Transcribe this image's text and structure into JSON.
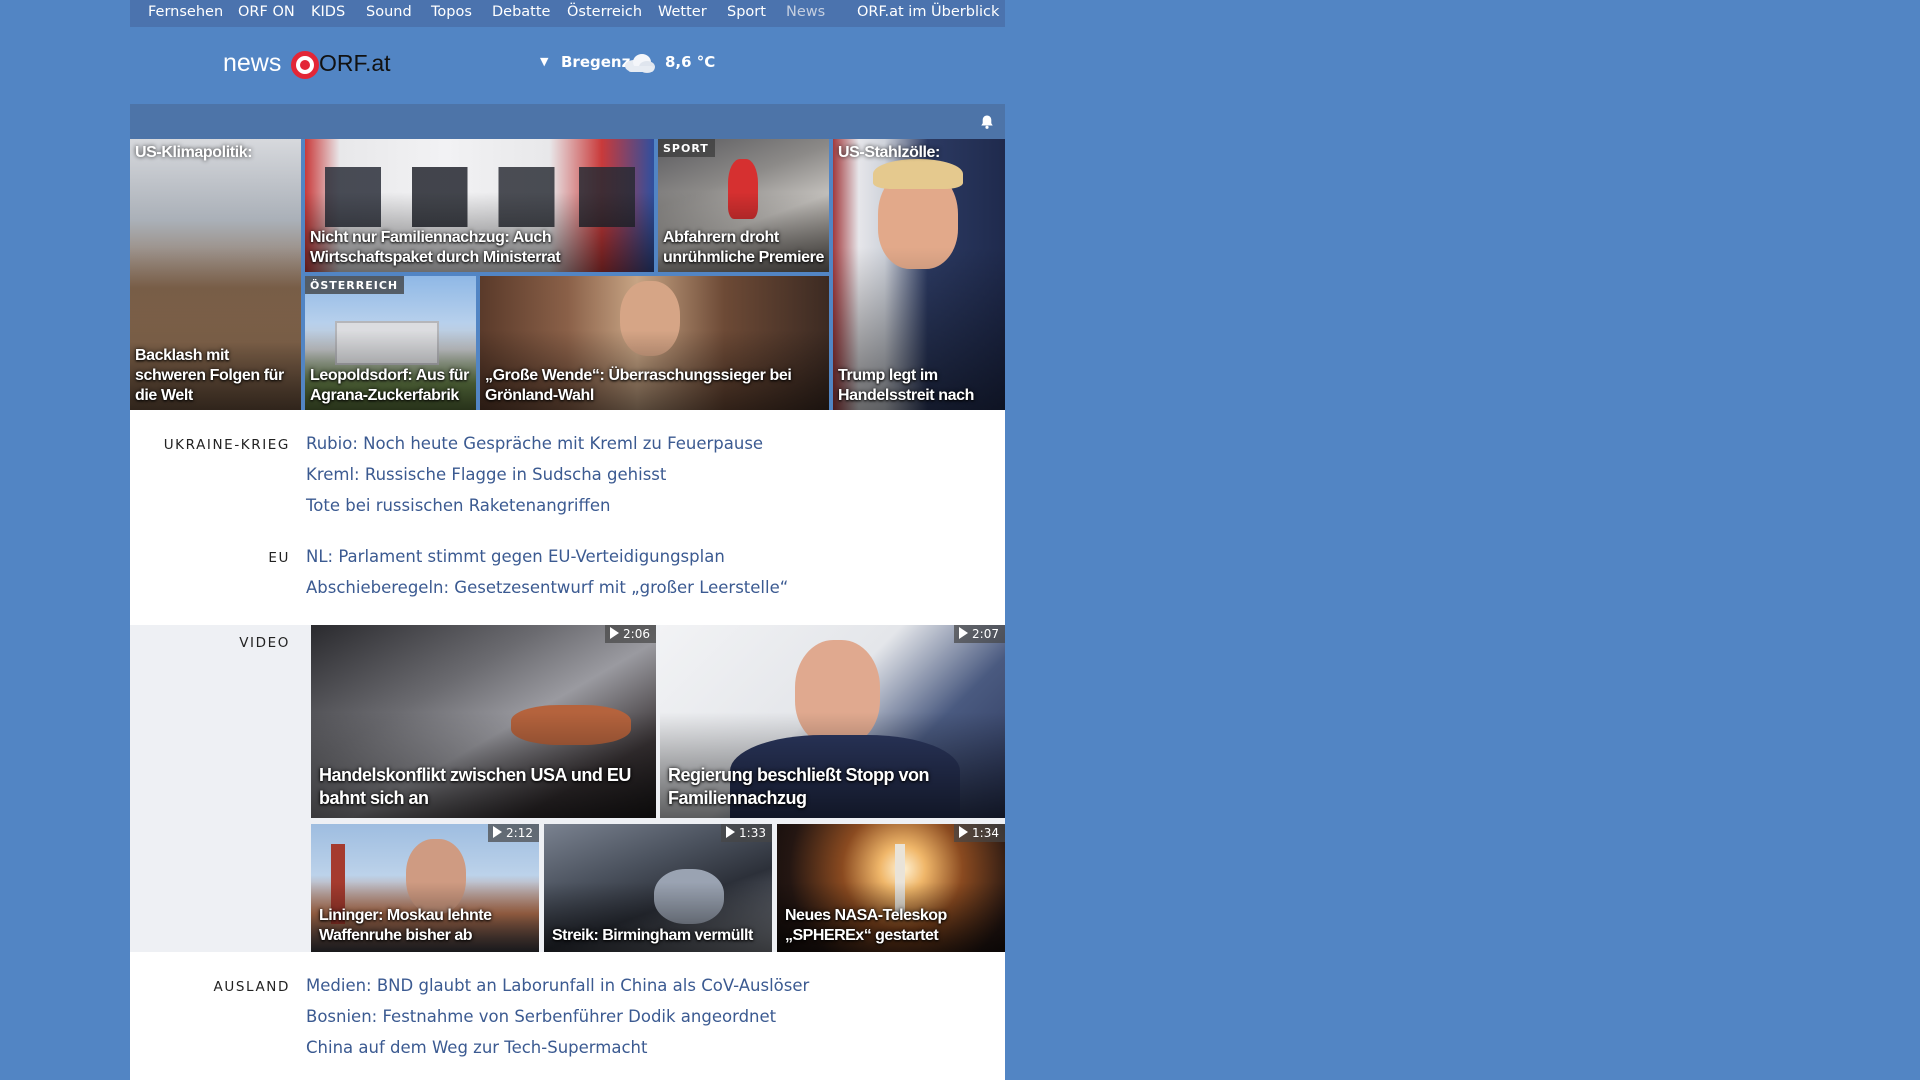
{
  "topnav": {
    "items": [
      "Fernsehen",
      "ORF ON",
      "KIDS",
      "Sound",
      "Topos",
      "Debatte",
      "Österreich",
      "Wetter",
      "Sport",
      "News"
    ],
    "overview": "ORF.at im Überblick"
  },
  "header": {
    "logo_news": "news",
    "logo_orf": "ORF.at",
    "weather_city": "Bregenz",
    "weather_temp": "8,6 °C",
    "weather_icon": "cloud-icon"
  },
  "teasers": [
    {
      "kicker": "US-Klimapolitik:",
      "caption": "Backlash mit schweren Folgen für die Welt"
    },
    {
      "caption": "Nicht nur Familiennachzug: Auch Wirtschaftspaket durch Ministerrat"
    },
    {
      "tag": "SPORT",
      "caption": "Abfahrern droht unrühmliche Premiere"
    },
    {
      "kicker": "US-Stahlzölle:",
      "caption": "Trump legt im Handelsstreit nach"
    },
    {
      "tag": "ÖSTERREICH",
      "caption": "Leopoldsdorf: Aus für Agrana-Zuckerfabrik"
    },
    {
      "caption": "„Große Wende“: Überraschungssieger bei Grönland-Wahl"
    }
  ],
  "sections": {
    "ukraine": {
      "label": "UKRAINE-KRIEG",
      "links": [
        "Rubio: Noch heute Gespräche mit Kreml zu Feuerpause",
        "Kreml: Russische Flagge in Sudscha gehisst",
        "Tote bei russischen Raketenangriffen"
      ]
    },
    "eu": {
      "label": "EU",
      "links": [
        "NL: Parlament stimmt gegen EU-Verteidigungsplan",
        "Abschieberegeln: Gesetzesentwurf mit „großer Leerstelle“"
      ]
    },
    "video": {
      "label": "VIDEO",
      "items": [
        {
          "duration": "2:06",
          "caption": "Handelskonflikt zwischen USA und EU bahnt sich an"
        },
        {
          "duration": "2:07",
          "caption": "Regierung beschließt Stopp von Familiennachzug"
        },
        {
          "duration": "2:12",
          "caption": "Lininger: Moskau lehnte Waffenruhe bisher ab"
        },
        {
          "duration": "1:33",
          "caption": "Streik: Birmingham vermüllt"
        },
        {
          "duration": "1:34",
          "caption": "Neues NASA-Teleskop „SPHEREx“ gestartet"
        }
      ]
    },
    "ausland": {
      "label": "AUSLAND",
      "links": [
        "Medien: BND glaubt an Laborunfall in China als CoV-Auslöser",
        "Bosnien: Festnahme von Serbenführer Dodik angeordnet",
        "China auf dem Weg zur Tech-Supermacht"
      ]
    }
  },
  "icons": {
    "bell": "bell-icon",
    "play": "play-icon"
  },
  "colors": {
    "page_bg": "#5285c4",
    "link": "#3b5a91",
    "orf_red": "#e32636"
  }
}
